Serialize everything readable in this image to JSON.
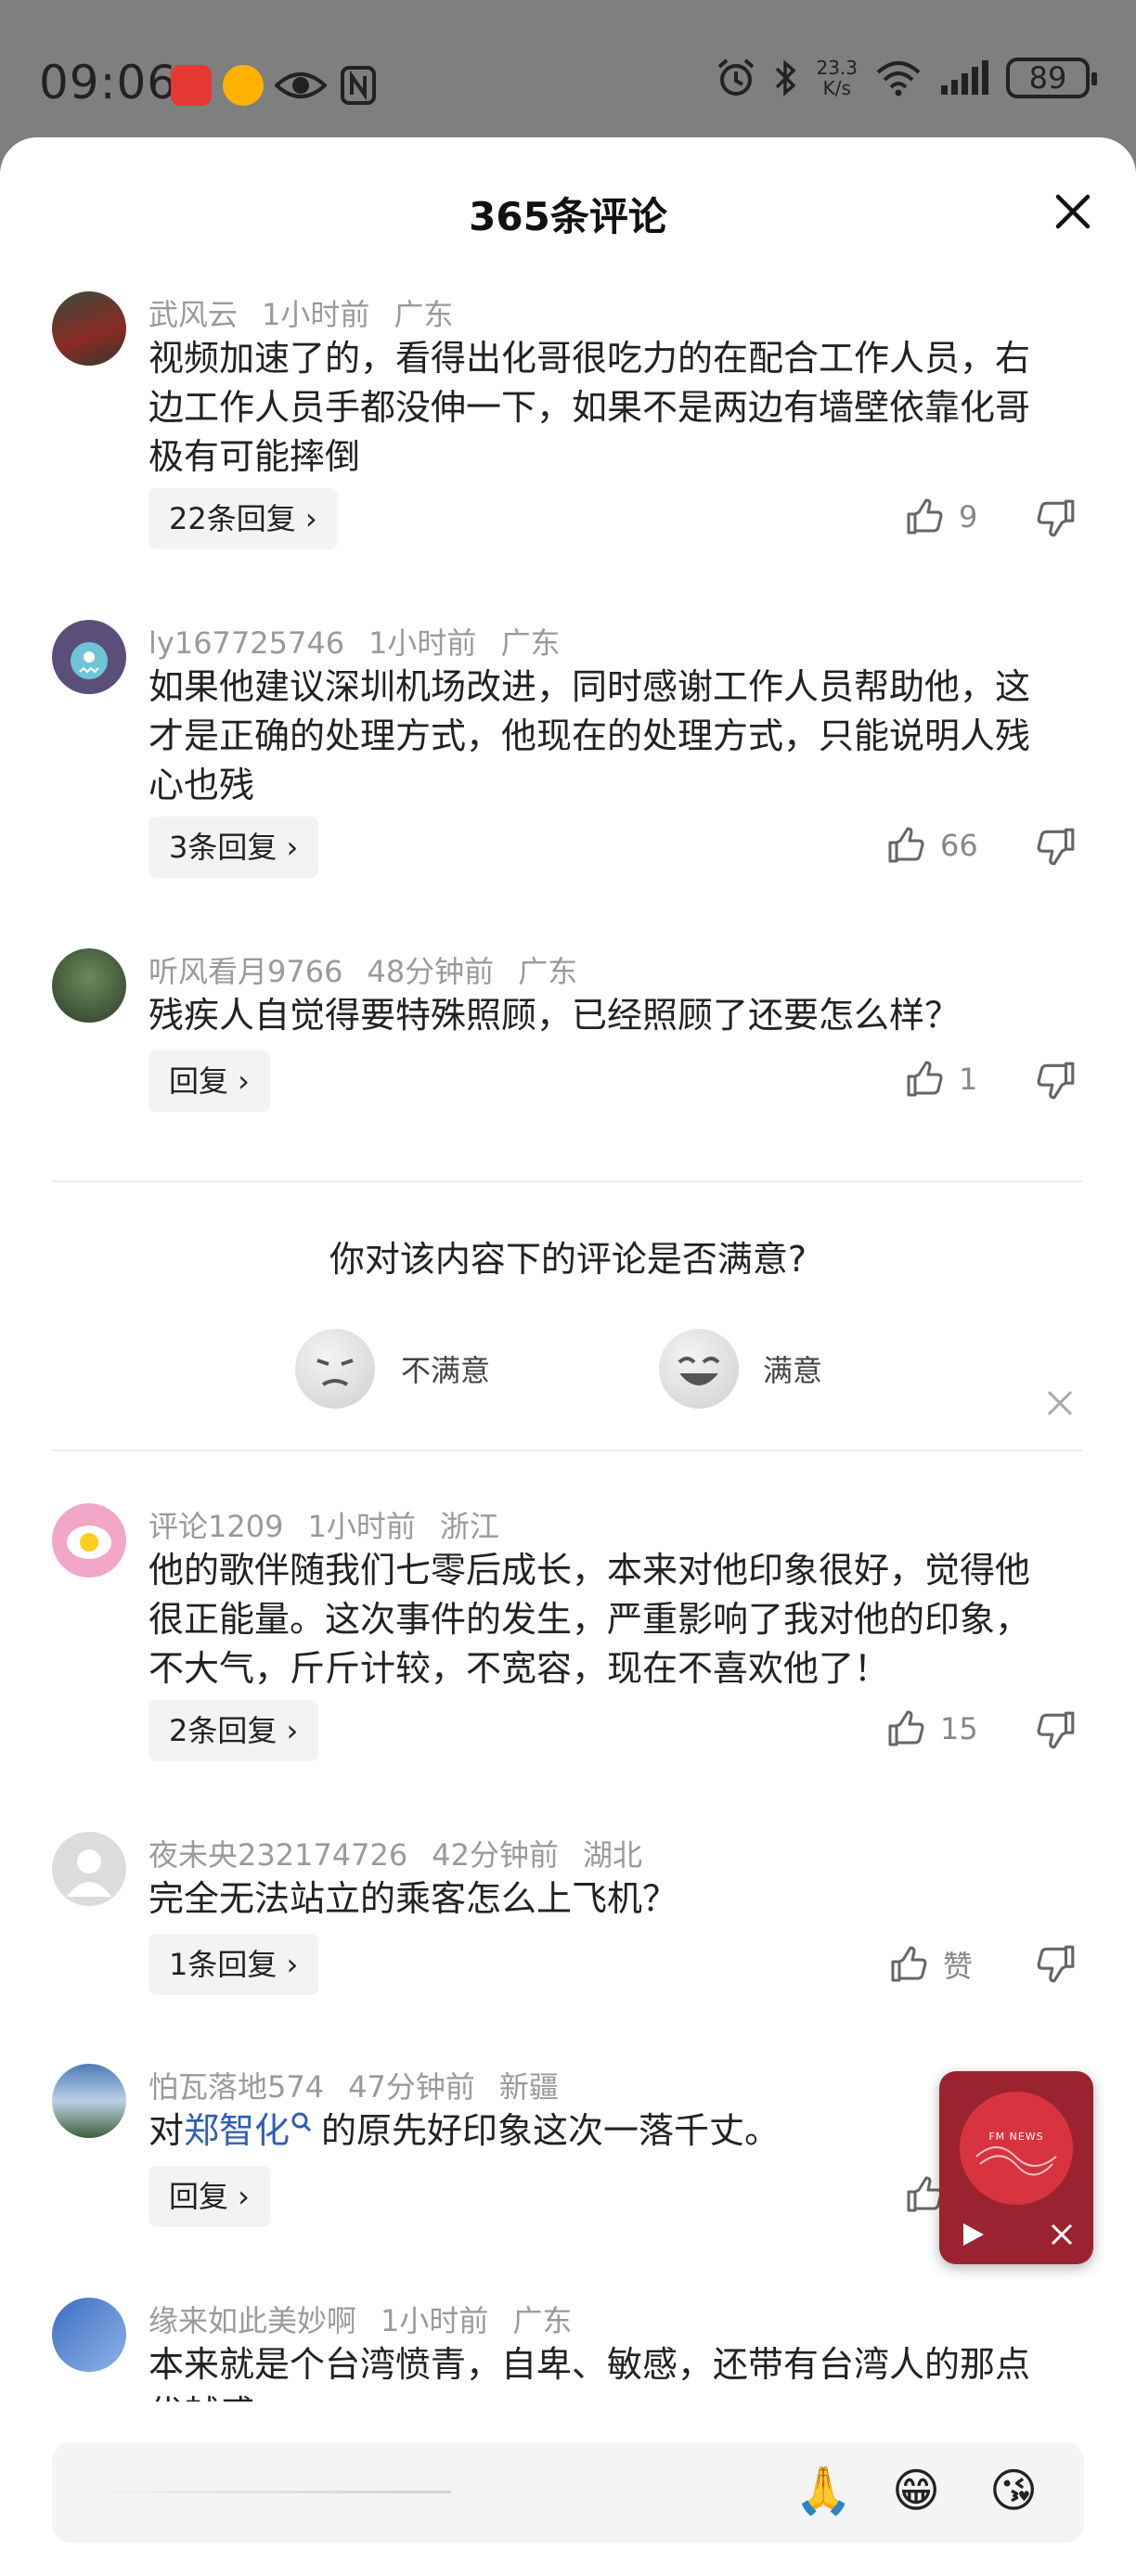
{
  "status": {
    "time": "09:06",
    "speed_value": "23.3",
    "speed_unit": "K/s",
    "battery": "89"
  },
  "sheet": {
    "title": "365条评论"
  },
  "comments": [
    {
      "user": "武风云",
      "time": "1小时前",
      "region": "广东",
      "lines": [
        "视频加速了的，看得出化哥很吃力的在配合工作人员，右",
        "边工作人员手都没伸一下，如果不是两边有墙壁依靠化哥",
        "极有可能摔倒"
      ],
      "reply": "22条回复 ›",
      "likes": "9"
    },
    {
      "user": "ly167725746",
      "time": "1小时前",
      "region": "广东",
      "lines": [
        "如果他建议深圳机场改进，同时感谢工作人员帮助他，这",
        "才是正确的处理方式，他现在的处理方式，只能说明人残",
        "心也残"
      ],
      "reply": "3条回复 ›",
      "likes": "66"
    },
    {
      "user": "听风看月9766",
      "time": "48分钟前",
      "region": "广东",
      "lines": [
        "残疾人自觉得要特殊照顾，已经照顾了还要怎么样？"
      ],
      "reply": "回复 ›",
      "likes": "1"
    },
    {
      "user": "评论1209",
      "time": "1小时前",
      "region": "浙江",
      "lines": [
        "他的歌伴随我们七零后成长，本来对他印象很好，觉得他",
        "很正能量。这次事件的发生，严重影响了我对他的印象，",
        "不大气，斤斤计较，不宽容，现在不喜欢他了！"
      ],
      "reply": "2条回复 ›",
      "likes": "15"
    },
    {
      "user": "夜未央232174726",
      "time": "42分钟前",
      "region": "湖北",
      "lines": [
        "完全无法站立的乘客怎么上飞机？"
      ],
      "reply": "1条回复 ›",
      "likes": "赞"
    },
    {
      "user": "怕瓦落地574",
      "time": "47分钟前",
      "region": "新疆",
      "prefix": "对",
      "mention": "郑智化",
      "suffix": "的原先好印象这次一落千丈。",
      "reply": "回复 ›"
    },
    {
      "user": "缘来如此美妙啊",
      "time": "1小时前",
      "region": "广东",
      "lines": [
        "本来就是个台湾愤青，自卑、敏感，还带有台湾人的那点",
        "优越感"
      ]
    }
  ],
  "survey": {
    "question": "你对该内容下的评论是否满意?",
    "unsatisfied": "不满意",
    "satisfied": "满意"
  },
  "player": {
    "brand": "FM NEWS"
  },
  "input": {
    "emojis": [
      "🙏",
      "😁",
      "😘"
    ]
  },
  "icons": {
    "close": "close-icon",
    "like": "thumbs-up-icon",
    "dislike": "thumbs-down-icon",
    "play": "play-icon",
    "search": "search-icon"
  }
}
